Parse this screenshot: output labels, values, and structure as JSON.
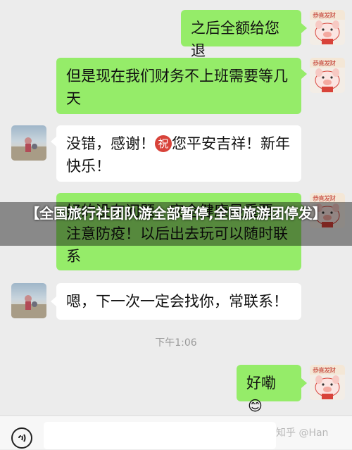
{
  "messages": [
    {
      "side": "me",
      "text": "之后全额给您退"
    },
    {
      "side": "me",
      "text": "但是现在我们财务不上班需要等几天"
    },
    {
      "side": "them",
      "text_before": "没错，感谢！",
      "emoji_char": "祝",
      "text_after": "您平安吉祥！新年快乐！"
    },
    {
      "side": "me",
      "text": "好的没有问题，安全健康最重要，注意防疫！以后出去玩可以随时联系"
    },
    {
      "side": "them",
      "text": "嗯，下一次一定会找你，常联系！"
    },
    {
      "side": "me",
      "text": "好嘞",
      "emoji": "😊"
    }
  ],
  "timestamp": "下午1:06",
  "banner": {
    "title": "【全国旅行社团队游全部暂停,全国旅游团停发】"
  },
  "watermark": "知乎 @Han",
  "colors": {
    "my_bubble": "#95ec69",
    "their_bubble": "#ffffff",
    "background": "#ececec",
    "avatar_red": "#d8433a"
  },
  "avatar_me_badge": "恭喜发财"
}
